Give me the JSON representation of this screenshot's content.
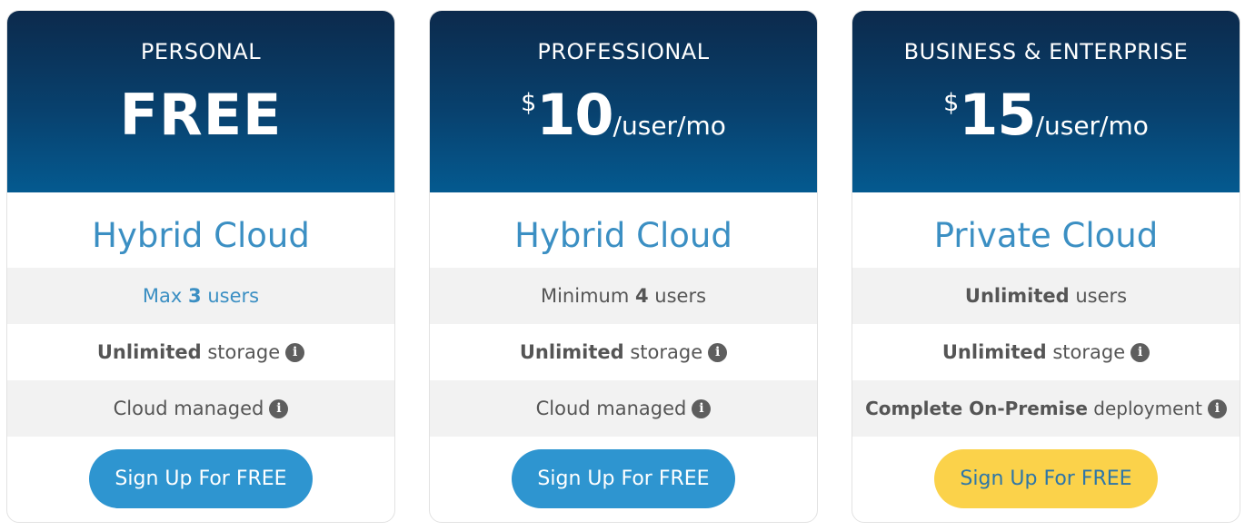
{
  "plans": [
    {
      "tier": "PERSONAL",
      "price_text": "FREE",
      "title": "Hybrid Cloud",
      "users": {
        "pre": "Max ",
        "bold": "3",
        "post": " users"
      },
      "storage": {
        "bold": "Unlimited",
        "post": " storage"
      },
      "managed": {
        "bold": "",
        "post": "Cloud managed"
      },
      "button": "Sign Up For FREE",
      "button_color": "#2e95d0"
    },
    {
      "tier": "PROFESSIONAL",
      "currency": "$",
      "amount": "10",
      "unit": "/user/mo",
      "title": "Hybrid Cloud",
      "users": {
        "pre": "Minimum ",
        "bold": "4",
        "post": " users"
      },
      "storage": {
        "bold": "Unlimited",
        "post": " storage"
      },
      "managed": {
        "bold": "",
        "post": "Cloud managed"
      },
      "button": "Sign Up For FREE",
      "button_color": "#2e95d0"
    },
    {
      "tier": "BUSINESS & ENTERPRISE",
      "currency": "$",
      "amount": "15",
      "unit": "/user/mo",
      "title": "Private Cloud",
      "users": {
        "pre": "",
        "bold": "Unlimited",
        "post": " users"
      },
      "storage": {
        "bold": "Unlimited",
        "post": " storage"
      },
      "managed": {
        "bold": "Complete On-Premise",
        "post": " deployment"
      },
      "button": "Sign Up For FREE",
      "button_color": "#fbd24a"
    }
  ],
  "info_icon_glyph": "i",
  "colors": {
    "header_top": "#0c2a4c",
    "header_bottom": "#045a90",
    "title_blue": "#3b8fc3",
    "stripe": "#f2f2f2"
  }
}
